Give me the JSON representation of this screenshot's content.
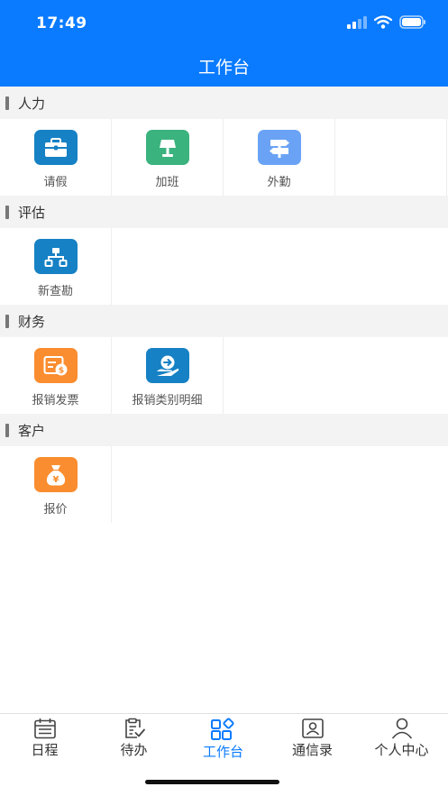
{
  "status_bar": {
    "time": "17:49"
  },
  "nav": {
    "title": "工作台"
  },
  "colors": {
    "primary": "#0a7bff",
    "blue_icon": "#1681c4",
    "green_icon": "#3bb37e",
    "light_blue_icon": "#6aa3f5",
    "orange_icon": "#fa8d2f"
  },
  "sections": [
    {
      "title": "人力",
      "items": [
        {
          "label": "请假",
          "icon": "briefcase-icon"
        },
        {
          "label": "加班",
          "icon": "lamp-icon"
        },
        {
          "label": "外勤",
          "icon": "signpost-icon"
        }
      ]
    },
    {
      "title": "评估",
      "items": [
        {
          "label": "新查勘",
          "icon": "org-chart-icon"
        }
      ]
    },
    {
      "title": "财务",
      "items": [
        {
          "label": "报销发票",
          "icon": "invoice-icon"
        },
        {
          "label": "报销类别明细",
          "icon": "hand-coin-icon"
        }
      ]
    },
    {
      "title": "客户",
      "items": [
        {
          "label": "报价",
          "icon": "money-bag-icon"
        }
      ]
    }
  ],
  "tabbar": [
    {
      "label": "日程",
      "icon": "calendar-icon",
      "active": false
    },
    {
      "label": "待办",
      "icon": "todo-icon",
      "active": false
    },
    {
      "label": "工作台",
      "icon": "workbench-icon",
      "active": true
    },
    {
      "label": "通信录",
      "icon": "contacts-icon",
      "active": false
    },
    {
      "label": "个人中心",
      "icon": "person-icon",
      "active": false
    }
  ]
}
